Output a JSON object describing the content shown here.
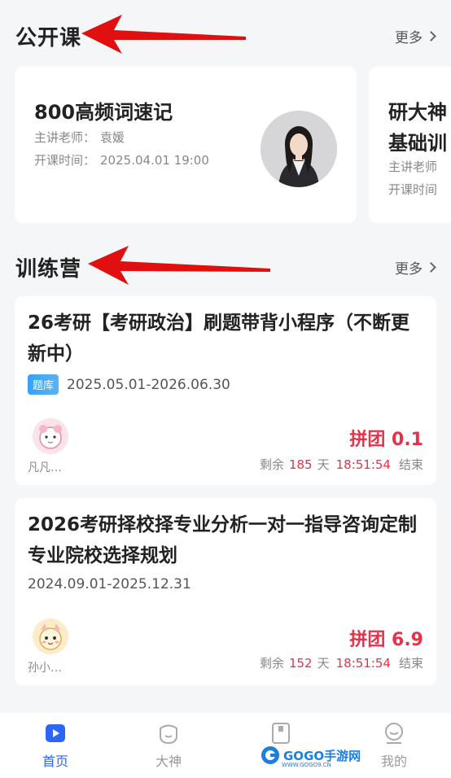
{
  "open_classes": {
    "title": "公开课",
    "more": "更多",
    "cards": [
      {
        "title": "800高频词速记",
        "teacher_label": "主讲老师：",
        "teacher": "袁媛",
        "time_label": "开课时间：",
        "time": "2025.04.01 19:00"
      },
      {
        "title_line1": "研大神",
        "title_line2": "基础训",
        "teacher_label": "主讲老师",
        "time_label": "开课时间"
      }
    ]
  },
  "training_camp": {
    "title": "训练营",
    "more": "更多",
    "items": [
      {
        "title": "26考研【考研政治】刷题带背小程序（不断更新中）",
        "tag": "题库",
        "date_range": "2025.05.01-2026.06.30",
        "user": "凡凡…",
        "price": "拼团 0.1",
        "remain_label": "剩余",
        "remain_days": "185",
        "days_unit": "天",
        "countdown": "18:51:54",
        "end_label": "结束"
      },
      {
        "title": "2026考研择校择专业分析一对一指导咨询定制专业院校选择规划",
        "date_range": "2024.09.01-2025.12.31",
        "user": "孙小…",
        "price": "拼团 6.9",
        "remain_label": "剩余",
        "remain_days": "152",
        "days_unit": "天",
        "countdown": "18:51:54",
        "end_label": "结束"
      }
    ]
  },
  "bottom_nav": [
    {
      "label": "首页",
      "icon": "home-icon",
      "active": true
    },
    {
      "label": "大神",
      "icon": "mascot-icon",
      "active": false
    },
    {
      "label": "",
      "icon": "book-icon",
      "active": false
    },
    {
      "label": "我的",
      "icon": "profile-icon",
      "active": false
    }
  ],
  "watermark": {
    "brand": "GOGO手游网",
    "url": "WWW.GOGO9.CN"
  },
  "colors": {
    "accent": "#2b66f6",
    "price": "#e5324a",
    "arrow": "#e01010",
    "tag": "#3aa0f0"
  }
}
